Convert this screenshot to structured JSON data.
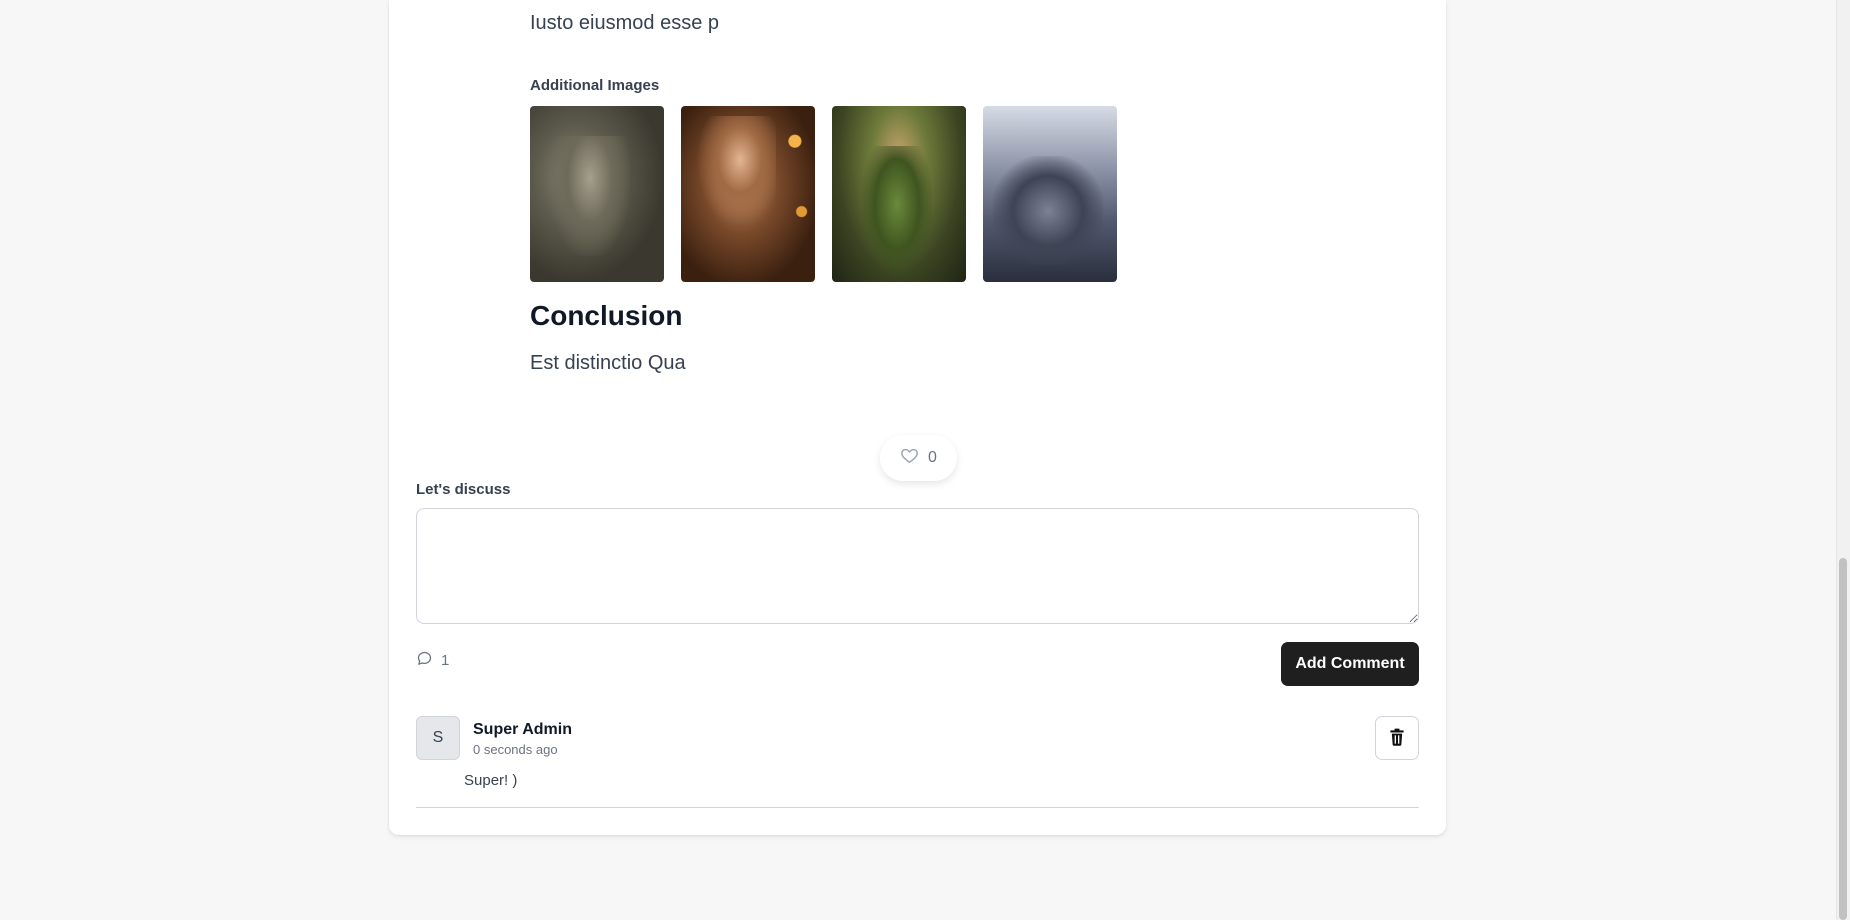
{
  "article": {
    "top_paragraph": "Iusto eiusmod esse p",
    "additional_images_label": "Additional Images",
    "images": [
      {
        "alt": "warrior-in-armor"
      },
      {
        "alt": "woman-in-candlelight"
      },
      {
        "alt": "bearded-man-in-forest"
      },
      {
        "alt": "armored-soldiers"
      }
    ],
    "conclusion_heading": "Conclusion",
    "conclusion_text": "Est distinctio Qua"
  },
  "likes": {
    "count": "0",
    "icon": "heart-icon"
  },
  "discussion": {
    "label": "Let's discuss",
    "input_value": "",
    "comment_count": "1",
    "comment_icon": "comment-bubble-icon",
    "submit_label": "Add Comment"
  },
  "comments": [
    {
      "avatar_initial": "S",
      "author": "Super Admin",
      "time": "0 seconds ago",
      "text": "Super! )",
      "delete_icon": "trash-icon"
    }
  ],
  "colors": {
    "primary_button": "#1f1f1f",
    "page_background": "#f7f7f8",
    "card_background": "#ffffff"
  }
}
